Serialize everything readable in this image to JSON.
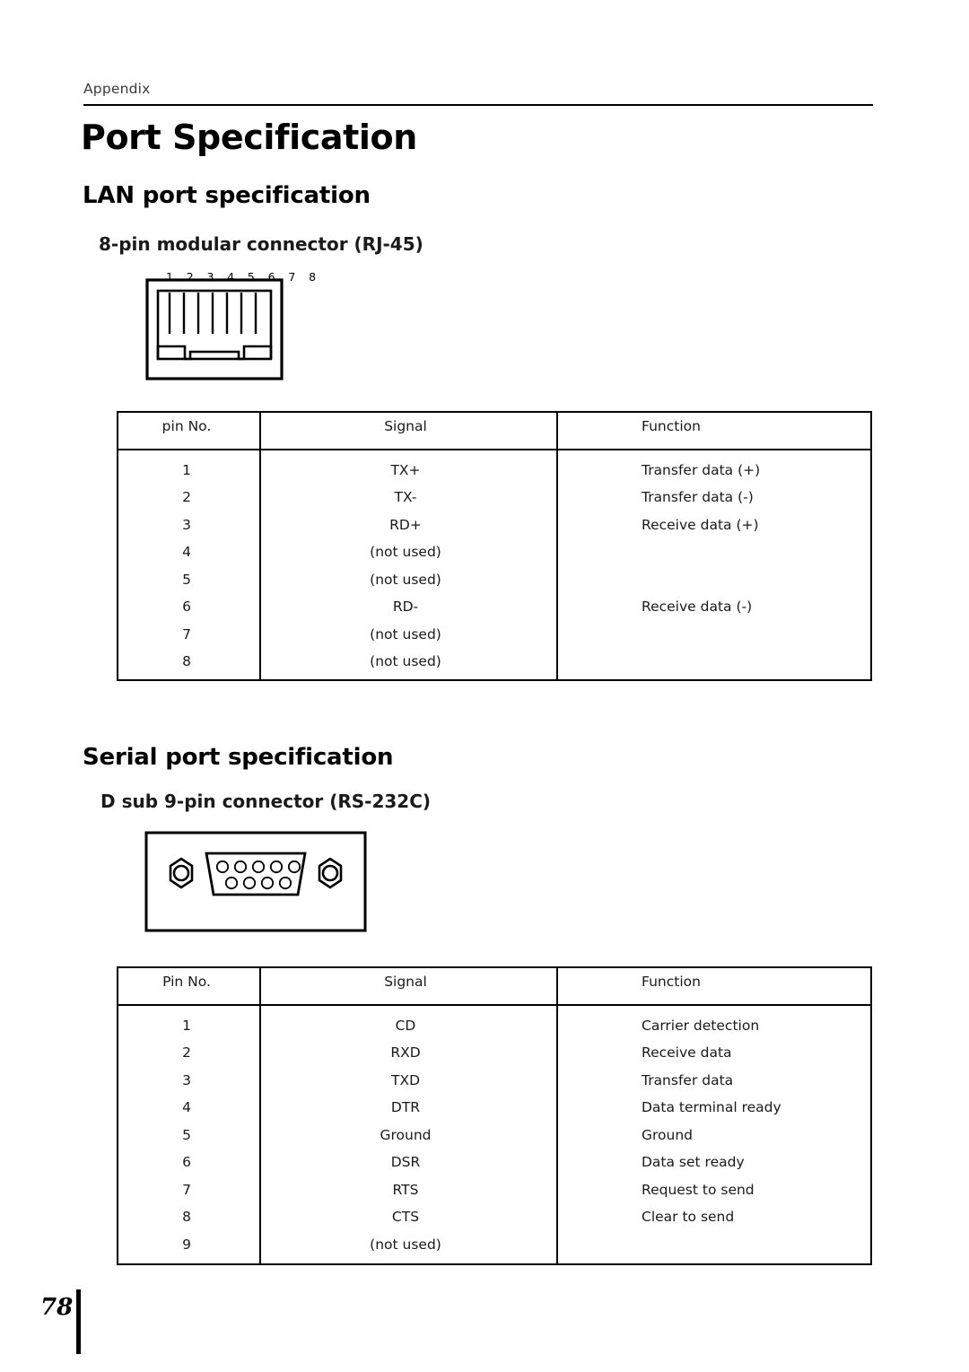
{
  "header": {
    "appendix_label": "Appendix"
  },
  "title": "Port Specification",
  "sections": [
    {
      "heading": "LAN port specification",
      "subheading": "8-pin modular connector (RJ-45)",
      "connector_pin_labels": "1 2 3 4 5 6 7 8",
      "table": {
        "columns": [
          "pin No.",
          "Signal",
          "Function"
        ],
        "rows": [
          [
            "1",
            "TX+",
            "Transfer data (+)"
          ],
          [
            "2",
            "TX-",
            "Transfer data (-)"
          ],
          [
            "3",
            "RD+",
            "Receive data (+)"
          ],
          [
            "4",
            "(not used)",
            ""
          ],
          [
            "5",
            "(not used)",
            ""
          ],
          [
            "6",
            "RD-",
            "Receive data (-)"
          ],
          [
            "7",
            "(not used)",
            ""
          ],
          [
            "8",
            "(not used)",
            ""
          ]
        ]
      }
    },
    {
      "heading": "Serial port specification",
      "subheading": "D sub 9-pin connector (RS-232C)",
      "table": {
        "columns": [
          "Pin No.",
          "Signal",
          "Function"
        ],
        "rows": [
          [
            "1",
            "CD",
            "Carrier detection"
          ],
          [
            "2",
            "RXD",
            "Receive data"
          ],
          [
            "3",
            "TXD",
            "Transfer data"
          ],
          [
            "4",
            "DTR",
            "Data terminal ready"
          ],
          [
            "5",
            "Ground",
            "Ground"
          ],
          [
            "6",
            "DSR",
            "Data set ready"
          ],
          [
            "7",
            "RTS",
            "Request to send"
          ],
          [
            "8",
            "CTS",
            "Clear to send"
          ],
          [
            "9",
            "(not used)",
            ""
          ]
        ]
      }
    }
  ],
  "footer": {
    "page_number": "78"
  }
}
